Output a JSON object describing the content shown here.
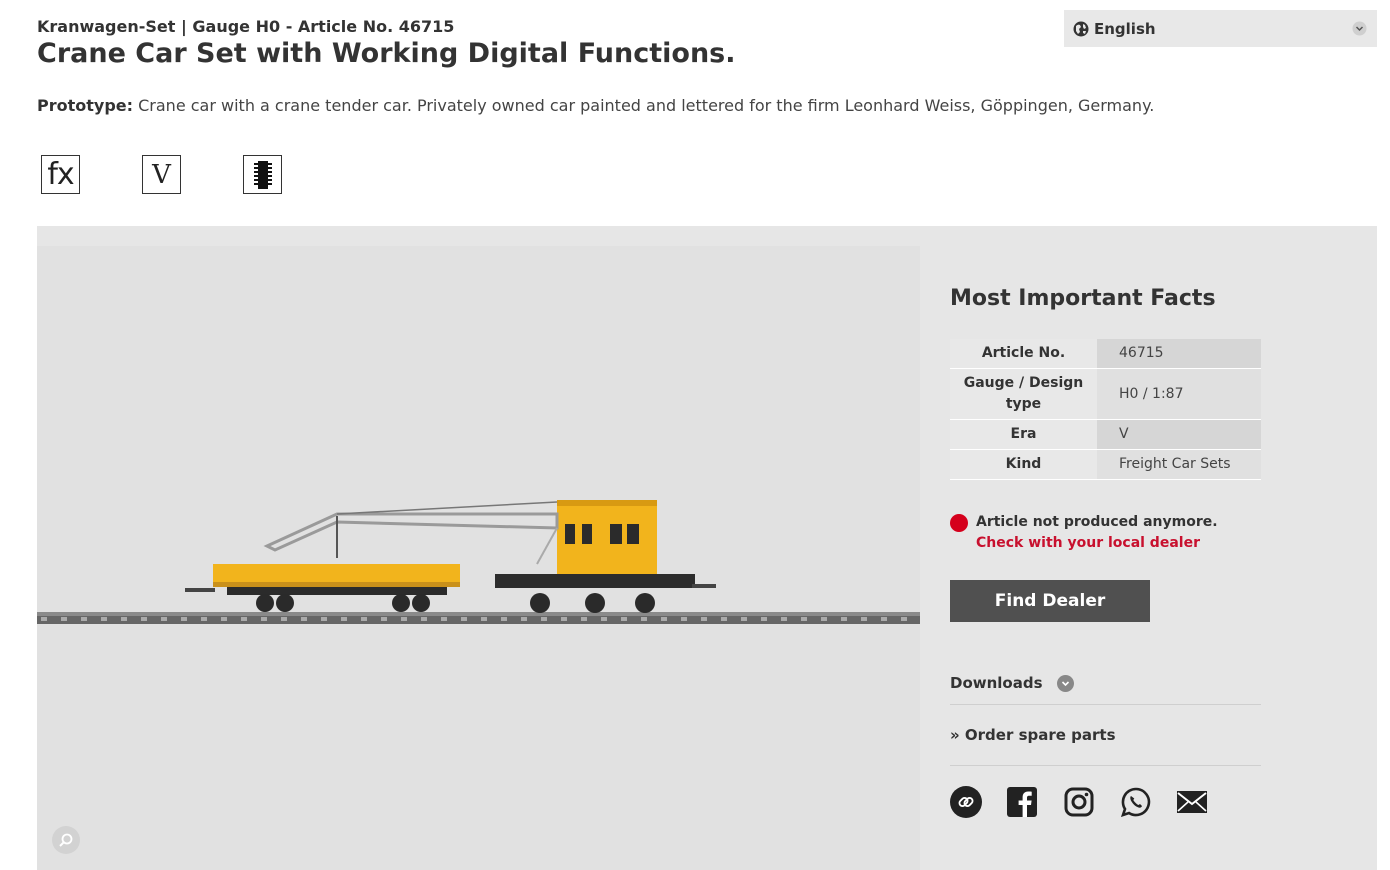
{
  "header": {
    "breadcrumb": "Kranwagen-Set | Gauge H0 - Article No. 46715",
    "title": "Crane Car Set with Working Digital Functions.",
    "prototype_label": "Prototype:",
    "prototype_text": " Crane car with a crane tender car. Privately owned car painted and lettered for the firm Leonhard Weiss, Göppingen, Germany."
  },
  "language": {
    "selected": "English",
    "icon": "globe-icon"
  },
  "feature_icons": [
    {
      "name": "fx-function-icon",
      "glyph": "fx"
    },
    {
      "name": "era-v-icon",
      "glyph": "V"
    },
    {
      "name": "digital-decoder-icon",
      "glyph": ""
    }
  ],
  "facts": {
    "title": "Most Important Facts",
    "rows": [
      {
        "key": "Article No.",
        "value": "46715"
      },
      {
        "key": "Gauge / Design type",
        "value": "H0 / 1:87"
      },
      {
        "key": "Era",
        "value": "V"
      },
      {
        "key": "Kind",
        "value": "Freight Car Sets"
      }
    ]
  },
  "status": {
    "text": "Article not produced anymore.",
    "link": "Check with your local dealer",
    "color": "#d5001c"
  },
  "actions": {
    "find_dealer": "Find Dealer",
    "downloads": "Downloads",
    "spare_parts": "» Order spare parts"
  },
  "social": [
    "copy-link-icon",
    "facebook-icon",
    "instagram-icon",
    "whatsapp-icon",
    "email-icon"
  ],
  "colors": {
    "accent_red": "#c8102e",
    "button_dark": "#505050",
    "model_yellow": "#f2b41c"
  }
}
